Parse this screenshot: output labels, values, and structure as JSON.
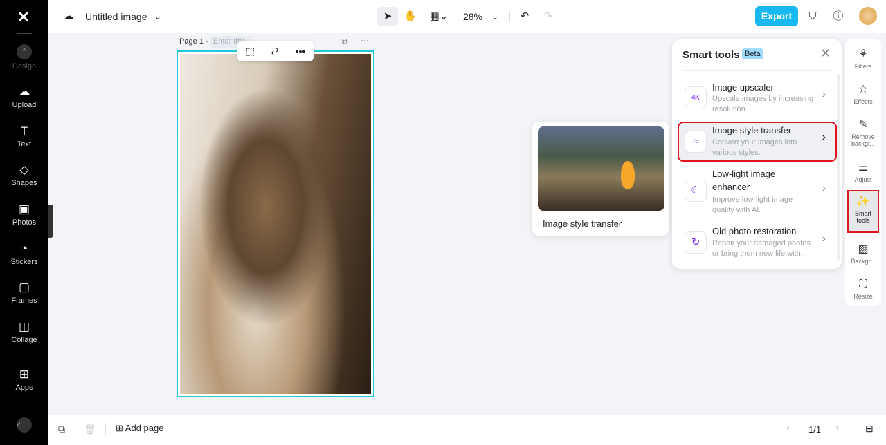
{
  "sidebar": {
    "items": [
      {
        "label": "Design",
        "icon": "chevron-up-icon"
      },
      {
        "label": "Upload",
        "icon": "upload-icon"
      },
      {
        "label": "Text",
        "icon": "text-icon"
      },
      {
        "label": "Shapes",
        "icon": "shapes-icon"
      },
      {
        "label": "Photos",
        "icon": "photos-icon"
      },
      {
        "label": "Stickers",
        "icon": "stickers-icon"
      },
      {
        "label": "Frames",
        "icon": "frames-icon"
      },
      {
        "label": "Collage",
        "icon": "collage-icon"
      },
      {
        "label": "Apps",
        "icon": "apps-icon"
      }
    ]
  },
  "header": {
    "title": "Untitled image",
    "zoom": "28%",
    "export": "Export"
  },
  "canvas": {
    "page_label": "Page 1 -",
    "title_placeholder": "Enter title"
  },
  "preview": {
    "caption": "Image style transfer"
  },
  "panel": {
    "title": "Smart tools",
    "badge": "Beta",
    "items": [
      {
        "title": "Image upscaler",
        "desc": "Upscale images by increasing resolution.",
        "icon": "4K"
      },
      {
        "title": "Image style transfer",
        "desc": "Convert your images into various styles.",
        "icon": "≈"
      },
      {
        "title": "Low-light image enhancer",
        "desc": "Improve low-light image quality with AI.",
        "icon": "☾"
      },
      {
        "title": "Old photo restoration",
        "desc": "Repair your damaged photos or bring them new life with...",
        "icon": "↻"
      }
    ]
  },
  "rightbar": {
    "items": [
      {
        "label": "Filters"
      },
      {
        "label": "Effects"
      },
      {
        "label": "Remove backgr..."
      },
      {
        "label": "Adjust"
      },
      {
        "label": "Smart tools"
      },
      {
        "label": "Backgr..."
      },
      {
        "label": "Resize"
      }
    ]
  },
  "bottom": {
    "add_page": "Add page",
    "page_count": "1/1"
  },
  "colors": {
    "accent": "#17b9f0",
    "highlight": "#e0141e",
    "purple": "#7b2ff7"
  }
}
